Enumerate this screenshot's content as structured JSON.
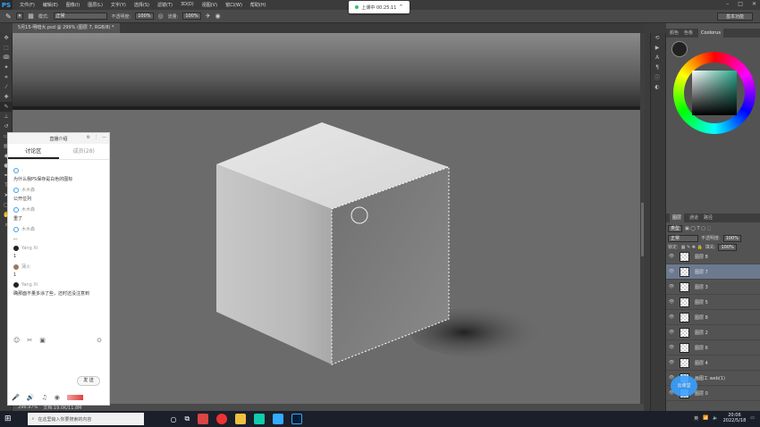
{
  "app": {
    "logo": "PS"
  },
  "menu": [
    "文件(F)",
    "编辑(E)",
    "图像(I)",
    "图层(L)",
    "文字(Y)",
    "选择(S)",
    "滤镜(T)",
    "3D(D)",
    "视图(V)",
    "窗口(W)",
    "帮助(H)"
  ],
  "options": {
    "mode_label": "模式:",
    "mode_value": "正常",
    "opacity_label": "不透明度:",
    "opacity_value": "100%",
    "flow_label": "流量:",
    "flow_value": "100%"
  },
  "live_badge": {
    "text": "上课中 00:25:11"
  },
  "workspace": "基本功能",
  "document_tab": "5月15-明暗大.psd @ 299% (图层 7, RGB/8) *",
  "status": {
    "zoom": "296.97%",
    "doc": "文档:19.0K/11.8M"
  },
  "color_panel": {
    "tabs": [
      "颜色",
      "色板",
      "Coolorus"
    ],
    "active": "Coolorus"
  },
  "layers_panel": {
    "tabs": [
      "图层",
      "通道",
      "路径"
    ],
    "kind_label": "类型",
    "blend_value": "正常",
    "opacity_label": "不透明度:",
    "opacity_value": "100%",
    "lock_label": "锁定:",
    "fill_label": "填充:",
    "fill_value": "100%",
    "layers": [
      {
        "name": "图层 8",
        "selected": false
      },
      {
        "name": "图层 7",
        "selected": true
      },
      {
        "name": "图层 3",
        "selected": false
      },
      {
        "name": "图层 5",
        "selected": false
      },
      {
        "name": "图层 8",
        "selected": false
      },
      {
        "name": "图层 2",
        "selected": false
      },
      {
        "name": "图层 6",
        "selected": false
      },
      {
        "name": "图层 4",
        "selected": false
      },
      {
        "name": "画图工 web(1)",
        "selected": false
      },
      {
        "name": "图层 0",
        "selected": false
      }
    ]
  },
  "chat": {
    "header": "直播介绍",
    "tabs": [
      "讨论区",
      "成员(28)"
    ],
    "active_tab": "讨论区",
    "messages": [
      {
        "user": "-",
        "text": "为什么我PS保存是白色的图标",
        "avatar": "blue"
      },
      {
        "user": "木木森",
        "text": "公开位列",
        "avatar": "blue"
      },
      {
        "user": "木木森",
        "text": "重了",
        "avatar": "blue"
      },
      {
        "user": "木木森",
        "text": "。。",
        "avatar": "blue"
      },
      {
        "user": "Yang Xi",
        "text": "1",
        "avatar": "dark"
      },
      {
        "user": "蒲火",
        "text": "1",
        "avatar": "photo"
      },
      {
        "user": "Yang Xi",
        "text": "确那面不量多涂了些，还时还没注意到",
        "avatar": "dark"
      }
    ],
    "send_label": "发 送"
  },
  "taskbar": {
    "search_placeholder": "在这里输入你要搜索的内容",
    "time": "20:06",
    "date": "2022/5/18",
    "ime": "英"
  },
  "watermark_badge": "云课堂"
}
